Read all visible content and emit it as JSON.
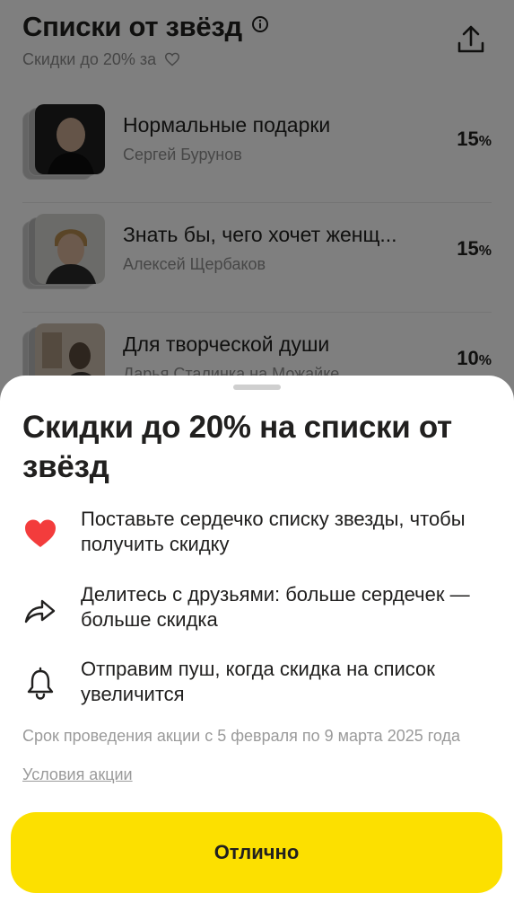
{
  "header": {
    "title": "Списки от звёзд",
    "subtitle": "Скидки до 20% за",
    "info_icon": "info-icon",
    "share_icon": "share-icon"
  },
  "items": [
    {
      "title": "Нормальные подарки",
      "author": "Сергей Бурунов",
      "discount": "15",
      "pct": "%"
    },
    {
      "title": "Знать бы, чего хочет женщ...",
      "author": "Алексей Щербаков",
      "discount": "15",
      "pct": "%"
    },
    {
      "title": "Для творческой души",
      "author": "Дарья Сталинка на Можайке",
      "discount": "10",
      "pct": "%"
    }
  ],
  "sheet": {
    "title": "Скидки до 20% на списки от звёзд",
    "features": [
      {
        "icon": "heart-icon",
        "text": "Поставьте сердечко списку звезды, чтобы получить скидку"
      },
      {
        "icon": "share-arrow-icon",
        "text": "Делитесь с друзьями: больше сердечек — больше скидка"
      },
      {
        "icon": "bell-icon",
        "text": "Отправим пуш, когда скидка на список увеличится"
      }
    ],
    "terms": "Срок проведения акции с 5 февраля по 9 марта 2025 года",
    "terms_link": "Условия акции",
    "ok_label": "Отлично"
  },
  "colors": {
    "accent_yellow": "#fce000",
    "heart_red": "#f33c3c",
    "overlay": "rgba(0,0,0,0.5)"
  }
}
